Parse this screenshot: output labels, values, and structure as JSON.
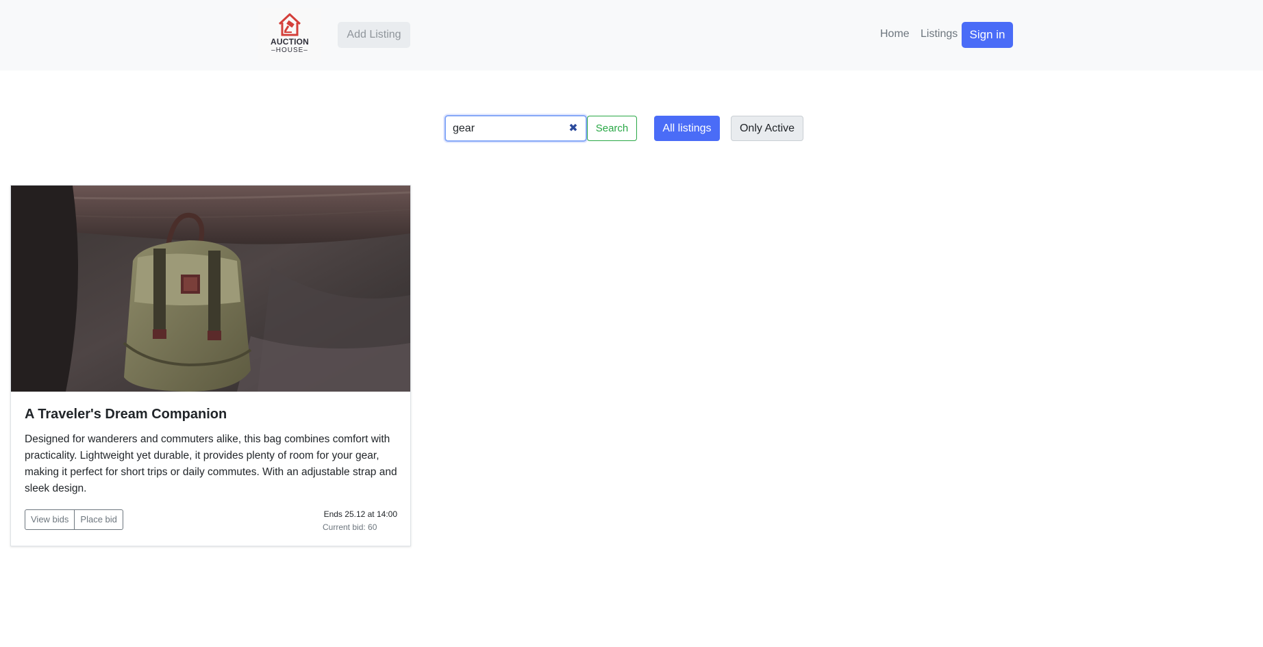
{
  "header": {
    "logo_line1": "AUCTION",
    "logo_line2": "–HOUSE–",
    "add_listing_label": "Add Listing",
    "nav": {
      "home": "Home",
      "listings": "Listings"
    },
    "sign_in_label": "Sign in",
    "brand_color": "#d43f3a",
    "accent_color": "#4a6cf7"
  },
  "search": {
    "value": "gear",
    "clear_icon": "✖",
    "button_label": "Search"
  },
  "filters": {
    "all_label": "All listings",
    "active_label": "Only Active"
  },
  "listing": {
    "image_icon": "backpack-photo",
    "title": "A Traveler's Dream Companion",
    "description": "Designed for wanderers and commuters alike, this bag combines comfort with practicality. Lightweight yet durable, it provides plenty of room for your gear, making it perfect for short trips or daily commutes. With an adjustable strap and sleek design.",
    "view_bids_label": "View bids",
    "place_bid_label": "Place bid",
    "ends_text": "Ends 25.12 at 14:00",
    "current_bid_text": "Current bid: 60"
  }
}
